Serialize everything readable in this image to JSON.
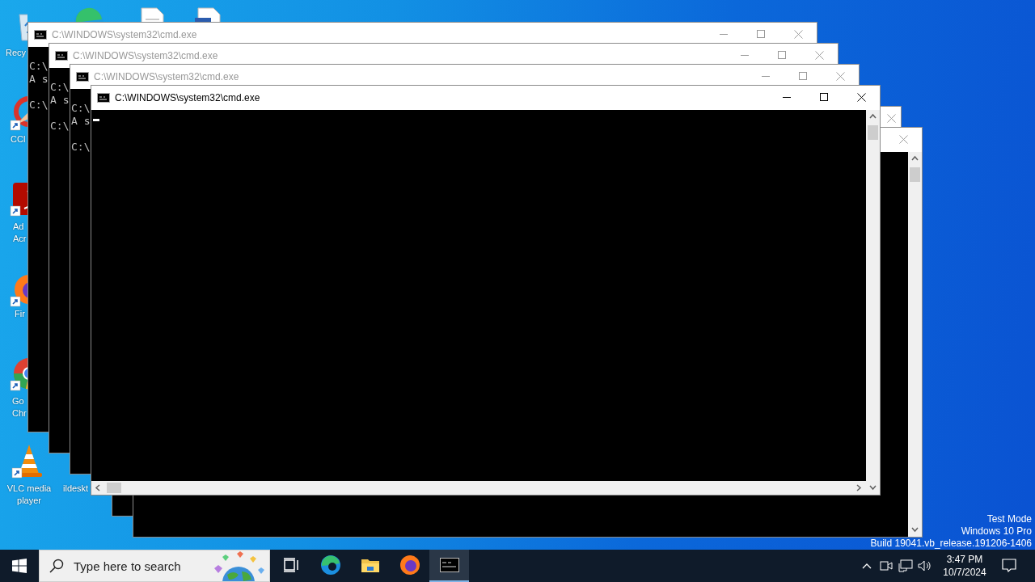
{
  "desktop": {
    "icons": [
      {
        "kind": "recycle-bin",
        "label_lines": [
          "Recy"
        ]
      },
      {
        "kind": "edge"
      },
      {
        "kind": "document"
      },
      {
        "kind": "word-document"
      },
      {
        "kind": "ccleaner",
        "shortcut": true,
        "label_lines": [
          "CCl"
        ]
      },
      {
        "kind": "acrobat",
        "shortcut": true,
        "label_lines": [
          "Ad",
          "Acr"
        ]
      },
      {
        "kind": "firefox",
        "shortcut": true,
        "label_lines": [
          "Fir"
        ]
      },
      {
        "kind": "chrome",
        "shortcut": true,
        "label_lines": [
          "Go",
          "Chr"
        ]
      },
      {
        "kind": "vlc",
        "shortcut": true,
        "label_lines": [
          "VLC media",
          "player"
        ]
      },
      {
        "kind": "hidden",
        "label_lines": [
          "ildeskt"
        ]
      }
    ],
    "system_info": [
      "Test Mode",
      "Windows 10 Pro",
      "Build 19041.vb_release.191206-1406"
    ]
  },
  "windows": [
    {
      "title": "C:\\WINDOWS\\system32\\cmd.exe",
      "active": false,
      "controls": [
        {
          "kind": "minimize"
        },
        {
          "kind": "maximize"
        },
        {
          "kind": "close"
        }
      ],
      "lines": [
        {
          "kind": "blank"
        },
        {
          "kind": "text",
          "text": "C:\\"
        },
        {
          "kind": "text",
          "text": "A s"
        },
        {
          "kind": "blank"
        },
        {
          "kind": "text",
          "text": "C:\\"
        }
      ]
    },
    {
      "title": "C:\\WINDOWS\\system32\\cmd.exe",
      "active": false,
      "controls": [
        {
          "kind": "minimize"
        },
        {
          "kind": "maximize"
        },
        {
          "kind": "close"
        }
      ],
      "lines": [
        {
          "kind": "blank"
        },
        {
          "kind": "text",
          "text": "C:\\"
        },
        {
          "kind": "text",
          "text": "A s"
        },
        {
          "kind": "blank"
        },
        {
          "kind": "text",
          "text": "C:\\"
        }
      ]
    },
    {
      "title": "C:\\WINDOWS\\system32\\cmd.exe",
      "active": false,
      "controls": [
        {
          "kind": "minimize"
        },
        {
          "kind": "maximize"
        },
        {
          "kind": "close"
        }
      ],
      "lines": [
        {
          "kind": "blank"
        },
        {
          "kind": "text",
          "text": "C:\\"
        },
        {
          "kind": "text",
          "text": "A s"
        },
        {
          "kind": "blank"
        },
        {
          "kind": "text",
          "text": "C:\\"
        }
      ]
    },
    {
      "active": false,
      "controls": [
        {
          "kind": "close"
        }
      ]
    },
    {
      "active": false,
      "controls": [
        {
          "kind": "close"
        }
      ],
      "vertical_scrollbar": true
    },
    {
      "title": "C:\\WINDOWS\\system32\\cmd.exe",
      "active": true,
      "controls": [
        {
          "kind": "minimize"
        },
        {
          "kind": "maximize"
        },
        {
          "kind": "close"
        }
      ],
      "cursor": true,
      "vertical_scrollbar": true,
      "horizontal_scrollbar": true
    }
  ],
  "taskbar": {
    "search": {
      "placeholder": "Type here to search"
    },
    "apps": [
      {
        "kind": "task-view",
        "active": false
      },
      {
        "kind": "edge",
        "active": false
      },
      {
        "kind": "explorer",
        "active": false
      },
      {
        "kind": "firefox",
        "active": false
      },
      {
        "kind": "cmd",
        "active": true
      }
    ],
    "tray": [
      {
        "kind": "chevron"
      },
      {
        "kind": "meet"
      },
      {
        "kind": "network"
      },
      {
        "kind": "volume"
      }
    ],
    "clock": {
      "time": "3:47 PM",
      "date": "10/7/2024"
    }
  }
}
